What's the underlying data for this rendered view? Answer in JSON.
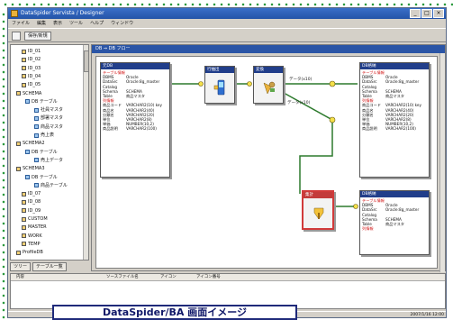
{
  "window": {
    "title": "DataSpider Servista / Designer",
    "controls": [
      "_",
      "□",
      "×"
    ]
  },
  "menu": [
    "ファイル",
    "編集",
    "表示",
    "ツール",
    "ヘルプ",
    "ウィンドウ"
  ],
  "toolbar": {
    "label": "保存/新規"
  },
  "tree": {
    "items": [
      {
        "label": "ID_01",
        "type": "db"
      },
      {
        "label": "ID_02",
        "type": "db"
      },
      {
        "label": "ID_03",
        "type": "db"
      },
      {
        "label": "ID_04",
        "type": "db"
      },
      {
        "label": "ID_05",
        "type": "db"
      },
      {
        "label": "SCHEMA",
        "type": "db"
      },
      {
        "label": "DB テーブル",
        "type": "table"
      },
      {
        "label": "社員マスタ",
        "type": "table"
      },
      {
        "label": "部署マスタ",
        "type": "table"
      },
      {
        "label": "商品マスタ",
        "type": "table"
      },
      {
        "label": "売上表",
        "type": "table"
      },
      {
        "label": "SCHEMA2",
        "type": "db"
      },
      {
        "label": "DB テーブル",
        "type": "table"
      },
      {
        "label": "売上データ",
        "type": "table"
      },
      {
        "label": "SCHEMA3",
        "type": "db"
      },
      {
        "label": "DB テーブル",
        "type": "table"
      },
      {
        "label": "商品テーブル",
        "type": "table"
      },
      {
        "label": "ID_07",
        "type": "db"
      },
      {
        "label": "ID_08",
        "type": "db"
      },
      {
        "label": "ID_09",
        "type": "db"
      },
      {
        "label": "CUSTOM",
        "type": "db"
      },
      {
        "label": "MASTER",
        "type": "db"
      },
      {
        "label": "WORK",
        "type": "db"
      },
      {
        "label": "TEMP",
        "type": "db"
      },
      {
        "label": "ProfileDB",
        "type": "db"
      }
    ],
    "tabs": [
      "ツリー",
      "テーブル一覧"
    ]
  },
  "designer": {
    "title": "DB ⇒ DB フロー",
    "source_node": {
      "title": "元DB",
      "rows": [
        {
          "k": "テーブル情報",
          "v": "",
          "red": true
        },
        {
          "k": "DBMS",
          "v": "Oracle"
        },
        {
          "k": "DataSrc",
          "v": "Oracle:8g_master"
        },
        {
          "k": "Catalog",
          "v": ""
        },
        {
          "k": "Schema",
          "v": "SCHEMA"
        },
        {
          "k": "Table",
          "v": "商品マスタ"
        },
        {
          "k": "列情報",
          "v": "",
          "red": true
        },
        {
          "k": "商品コード",
          "v": "VARCHAR2(10) key"
        },
        {
          "k": "商品名",
          "v": "VARCHAR2(40)"
        },
        {
          "k": "分類名",
          "v": "VARCHAR2(20)"
        },
        {
          "k": "単位",
          "v": "VARCHAR2(8)"
        },
        {
          "k": "単価",
          "v": "NUMBER(10,2)"
        },
        {
          "k": "商品説明",
          "v": "VARCHAR2(100)"
        }
      ]
    },
    "steps": [
      {
        "id": "step1",
        "label": "行抽出"
      },
      {
        "id": "step2",
        "label": "変換"
      },
      {
        "id": "step3",
        "label": "集計"
      }
    ],
    "link_labels": [
      "データ(x10)",
      "データ(x10)"
    ],
    "target_top": {
      "title": "DB格納",
      "rows": [
        {
          "k": "テーブル情報",
          "v": "",
          "red": true
        },
        {
          "k": "DBMS",
          "v": "Oracle"
        },
        {
          "k": "DataSrc",
          "v": "Oracle:8g_master"
        },
        {
          "k": "Catalog",
          "v": ""
        },
        {
          "k": "Schema",
          "v": "SCHEMA"
        },
        {
          "k": "Table",
          "v": "商品マスタ"
        },
        {
          "k": "列情報",
          "v": "",
          "red": true
        },
        {
          "k": "商品コード",
          "v": "VARCHAR2(10) key"
        },
        {
          "k": "商品名",
          "v": "VARCHAR2(40)"
        },
        {
          "k": "分類名",
          "v": "VARCHAR2(20)"
        },
        {
          "k": "単位",
          "v": "VARCHAR2(8)"
        },
        {
          "k": "単価",
          "v": "NUMBER(10,2)"
        },
        {
          "k": "商品説明",
          "v": "VARCHAR2(100)"
        }
      ]
    },
    "target_bottom": {
      "title": "DB格納",
      "rows": [
        {
          "k": "テーブル情報",
          "v": "",
          "red": true
        },
        {
          "k": "DBMS",
          "v": "Oracle"
        },
        {
          "k": "DataSrc",
          "v": "Oracle:8g_master"
        },
        {
          "k": "Catalog",
          "v": ""
        },
        {
          "k": "Schema",
          "v": "SCHEMA"
        },
        {
          "k": "Table",
          "v": "商品マスタ"
        },
        {
          "k": "列情報",
          "v": "",
          "red": true
        }
      ]
    }
  },
  "status": {
    "columns": [
      "内容",
      "ソースファイル名",
      "アイコン",
      "アイコン番号"
    ]
  },
  "bottom": {
    "time": "2007/1/16 12:00"
  },
  "caption": "DataSpider/BA 画面イメージ",
  "colors": {
    "accent": "#213e8a",
    "highlight": "#d13a3a",
    "frame": "#2b9a3e"
  }
}
